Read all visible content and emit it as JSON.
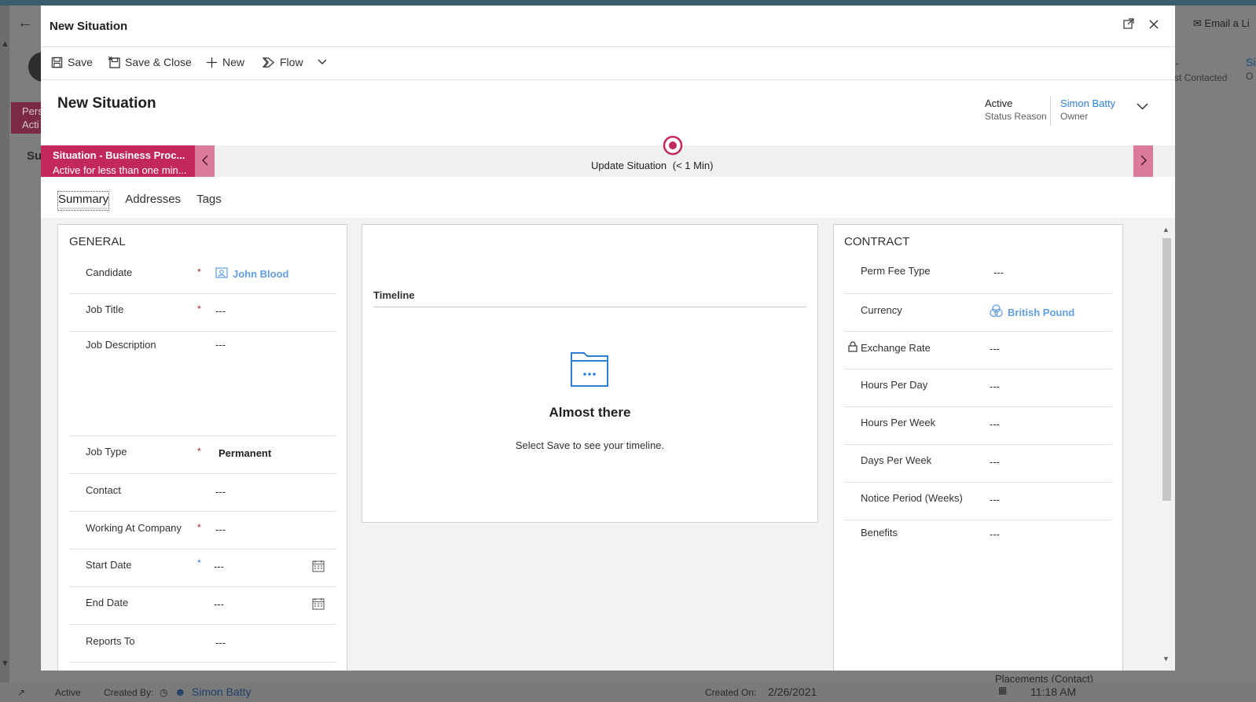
{
  "background": {
    "email_label": "Email a Li",
    "last_contacted_label": "st Contacted",
    "si_text": "Si",
    "oi_text": "O",
    "pers_text": "Pers",
    "acti_text": "Acti",
    "su_text": "Su",
    "statusbar": {
      "status": "Active",
      "created_by_label": "Created By:",
      "created_by_value": "Simon Batty",
      "created_on_label": "Created On:",
      "created_on_value": "2/26/2021",
      "time_value": "11:18 AM",
      "placements_label": "Placements (Contact)"
    }
  },
  "modal": {
    "title": "New Situation",
    "toolbar": {
      "save": "Save",
      "save_close": "Save & Close",
      "new": "New",
      "flow": "Flow"
    },
    "record": {
      "title": "New Situation",
      "status_value": "Active",
      "status_label": "Status Reason",
      "owner_value": "Simon Batty",
      "owner_label": "Owner"
    },
    "bpf": {
      "stage_name": "Situation - Business Proc...",
      "stage_duration": "Active for less than one min...",
      "active_stage": "Update Situation",
      "active_stage_time": "(< 1 Min)"
    },
    "tabs": [
      "Summary",
      "Addresses",
      "Tags"
    ],
    "general": {
      "title": "GENERAL",
      "fields": {
        "candidate": {
          "label": "Candidate",
          "value": "John Blood"
        },
        "job_title": {
          "label": "Job Title",
          "value": "---"
        },
        "job_description": {
          "label": "Job Description",
          "value": "---"
        },
        "job_type": {
          "label": "Job Type",
          "value": "Permanent"
        },
        "contact": {
          "label": "Contact",
          "value": "---"
        },
        "working_at_company": {
          "label": "Working At Company",
          "value": "---"
        },
        "start_date": {
          "label": "Start Date",
          "value": "---"
        },
        "end_date": {
          "label": "End Date",
          "value": "---"
        },
        "reports_to": {
          "label": "Reports To",
          "value": "---"
        }
      }
    },
    "timeline": {
      "title": "Timeline",
      "heading": "Almost there",
      "message": "Select Save to see your timeline."
    },
    "contract": {
      "title": "CONTRACT",
      "fields": {
        "perm_fee_type": {
          "label": "Perm Fee Type",
          "value": "---"
        },
        "currency": {
          "label": "Currency",
          "value": "British Pound"
        },
        "exchange_rate": {
          "label": "Exchange Rate",
          "value": "---"
        },
        "hours_per_day": {
          "label": "Hours Per Day",
          "value": "---"
        },
        "hours_per_week": {
          "label": "Hours Per Week",
          "value": "---"
        },
        "days_per_week": {
          "label": "Days Per Week",
          "value": "---"
        },
        "notice_period": {
          "label": "Notice Period (Weeks)",
          "value": "---"
        },
        "benefits": {
          "label": "Benefits",
          "value": "---"
        }
      }
    }
  },
  "colors": {
    "accent": "#c2285b",
    "link": "#2b7fd6",
    "required": "#a4262c"
  },
  "icons": [
    "save-icon",
    "save-close-icon",
    "plus-icon",
    "flow-icon",
    "chevron-down-icon",
    "expand-icon",
    "close-icon",
    "target-icon",
    "calendar-icon",
    "lock-icon",
    "contact-icon",
    "currency-icon",
    "folder-icon"
  ]
}
